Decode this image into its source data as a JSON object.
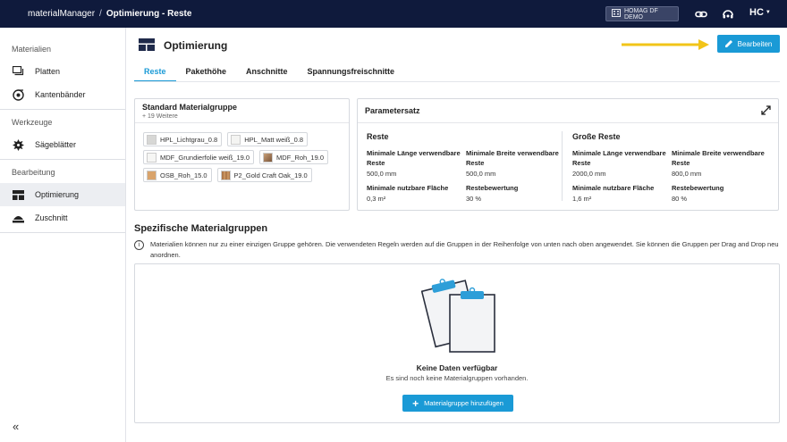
{
  "topbar": {
    "app_name": "materialManager",
    "separator": "/",
    "current_page": "Optimierung - Reste",
    "tenant": "HOMAG DF DEMO",
    "user_initials": "HC"
  },
  "sidebar": {
    "sections": [
      {
        "label": "Materialien",
        "items": [
          {
            "label": "Platten",
            "icon": "panels-icon"
          },
          {
            "label": "Kantenbänder",
            "icon": "edgeband-icon"
          }
        ]
      },
      {
        "label": "Werkzeuge",
        "items": [
          {
            "label": "Sägeblätter",
            "icon": "sawblade-icon"
          }
        ]
      },
      {
        "label": "Bearbeitung",
        "items": [
          {
            "label": "Optimierung",
            "icon": "optimization-icon",
            "active": true
          },
          {
            "label": "Zuschnitt",
            "icon": "cutting-icon"
          }
        ]
      }
    ],
    "collapse_label": "«"
  },
  "page": {
    "title": "Optimierung",
    "edit_button": "Bearbeiten",
    "tabs": [
      "Reste",
      "Pakethöhe",
      "Anschnitte",
      "Spannungsfreischnitte"
    ],
    "active_tab": "Reste"
  },
  "standard_group": {
    "title": "Standard Materialgruppe",
    "subtitle": "+ 19 Weitere",
    "chips": [
      {
        "label": "HPL_Lichtgrau_0.8",
        "swatch": "#d7d7d5"
      },
      {
        "label": "HPL_Matt weiß_0.8",
        "swatch": "#f4f4f2"
      },
      {
        "label": "MDF_Grundierfolie weiß_19.0",
        "swatch": "#f6f6f4"
      },
      {
        "label": "MDF_Roh_19.0",
        "swatch": "#a57c5a"
      },
      {
        "label": "OSB_Roh_15.0",
        "swatch": "#d9a46c"
      },
      {
        "label": "P2_Gold Craft Oak_19.0",
        "swatch": "#b07a4b"
      }
    ]
  },
  "parameter_set": {
    "title": "Parametersatz",
    "groups": [
      {
        "heading": "Reste",
        "fields": [
          {
            "label": "Minimale Länge verwendbare Reste",
            "value": "500,0 mm"
          },
          {
            "label": "Minimale Breite verwendbare Reste",
            "value": "500,0 mm"
          },
          {
            "label": "Minimale nutzbare Fläche",
            "value": "0,3 m²"
          },
          {
            "label": "Restebewertung",
            "value": "30 %"
          }
        ]
      },
      {
        "heading": "Große Reste",
        "fields": [
          {
            "label": "Minimale Länge verwendbare Reste",
            "value": "2000,0 mm"
          },
          {
            "label": "Minimale Breite verwendbare Reste",
            "value": "800,0 mm"
          },
          {
            "label": "Minimale nutzbare Fläche",
            "value": "1,6 m²"
          },
          {
            "label": "Restebewertung",
            "value": "80 %"
          }
        ]
      }
    ]
  },
  "specific_groups": {
    "title": "Spezifische Materialgruppen",
    "info": "Materialien können nur zu einer einzigen Gruppe gehören. Die verwendeten Regeln werden auf die Gruppen in der Reihenfolge von unten nach oben angewendet. Sie können die Gruppen per Drag and Drop neu anordnen.",
    "empty_title": "Keine Daten verfügbar",
    "empty_subtitle": "Es sind noch keine Materialgruppen vorhanden.",
    "add_button": "Materialgruppe hinzufügen"
  },
  "colors": {
    "topbar": "#0f1a3c",
    "accent": "#1a9ad6",
    "annotation_arrow": "#f2c418"
  }
}
